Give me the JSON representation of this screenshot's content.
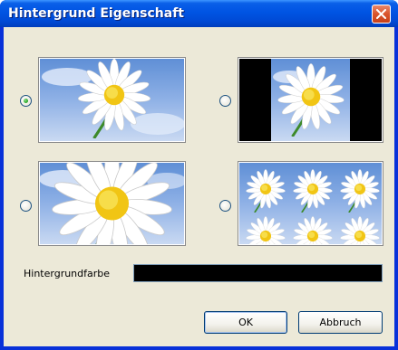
{
  "window": {
    "title": "Hintergrund Eigenschaft"
  },
  "options": [
    {
      "id": "center-scaled",
      "selected": true,
      "icon": "daisy-fit-thumbnail"
    },
    {
      "id": "center",
      "selected": false,
      "icon": "daisy-center-black-bars-thumbnail"
    },
    {
      "id": "stretch",
      "selected": false,
      "icon": "daisy-stretch-thumbnail"
    },
    {
      "id": "tile",
      "selected": false,
      "icon": "daisy-tile-thumbnail"
    }
  ],
  "background_color": {
    "label": "Hintergrundfarbe",
    "value": "#000000"
  },
  "buttons": {
    "ok": "OK",
    "cancel": "Abbruch"
  },
  "colors": {
    "title_bar": "#0054e3",
    "dialog_bg": "#ece9d8",
    "radio_dot": "#21a121",
    "close_button": "#d9542c"
  }
}
